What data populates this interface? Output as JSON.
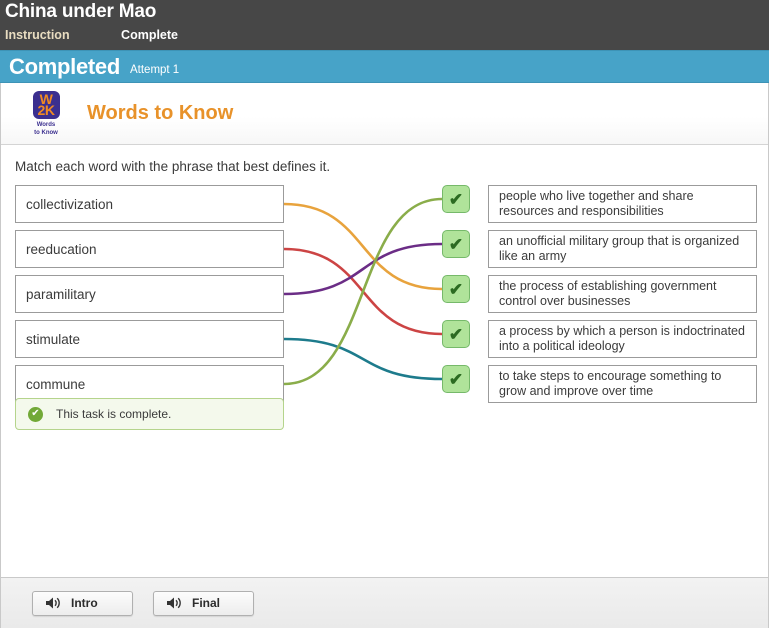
{
  "header": {
    "course_title": "China under Mao",
    "breadcrumb": {
      "current": "Instruction",
      "next": "Complete"
    }
  },
  "status_banner": {
    "label": "Completed",
    "attempt": "Attempt 1",
    "color": "#47a3c8"
  },
  "activity": {
    "logo": {
      "line1": "W",
      "line2": "2K",
      "caption_line1": "Words",
      "caption_line2": "to Know",
      "badge_color": "#3b2f8f",
      "badge_text_color": "#f08a22"
    },
    "title": "Words to Know",
    "title_color": "#e8922a",
    "prompt": "Match each word with the phrase that best defines it."
  },
  "terms": [
    {
      "label": "collectivization",
      "line_color": "#e8a33d"
    },
    {
      "label": "reeducation",
      "line_color": "#cc4444"
    },
    {
      "label": "paramilitary",
      "line_color": "#6b2d86"
    },
    {
      "label": "stimulate",
      "line_color": "#1d7b8c"
    },
    {
      "label": "commune",
      "line_color": "#8aad4a"
    }
  ],
  "definitions": [
    {
      "label": "people who live together and share resources and responsibilities"
    },
    {
      "label": "an unofficial military group that is organized like an army"
    },
    {
      "label": "the process of establishing government control over businesses"
    },
    {
      "label": "a process by which a person is indoctrinated into a political ideology"
    },
    {
      "label": "to take steps to encourage something to grow and improve over time"
    }
  ],
  "matches": [
    {
      "term_index": 0,
      "definition_index": 2,
      "color": "#e8a33d",
      "correct": true
    },
    {
      "term_index": 1,
      "definition_index": 3,
      "color": "#cc4444",
      "correct": true
    },
    {
      "term_index": 2,
      "definition_index": 1,
      "color": "#6b2d86",
      "correct": true
    },
    {
      "term_index": 3,
      "definition_index": 4,
      "color": "#1d7b8c",
      "correct": true
    },
    {
      "term_index": 4,
      "definition_index": 0,
      "color": "#8aad4a",
      "correct": true
    }
  ],
  "check_marks": [
    {
      "glyph": "✔"
    },
    {
      "glyph": "✔"
    },
    {
      "glyph": "✔"
    },
    {
      "glyph": "✔"
    },
    {
      "glyph": "✔"
    }
  ],
  "completion": {
    "icon_glyph": "✔",
    "text": "This task is complete.",
    "accent_color": "#72a937"
  },
  "footer": {
    "buttons": [
      {
        "label": "Intro",
        "icon": "speaker-icon"
      },
      {
        "label": "Final",
        "icon": "speaker-icon"
      }
    ]
  }
}
